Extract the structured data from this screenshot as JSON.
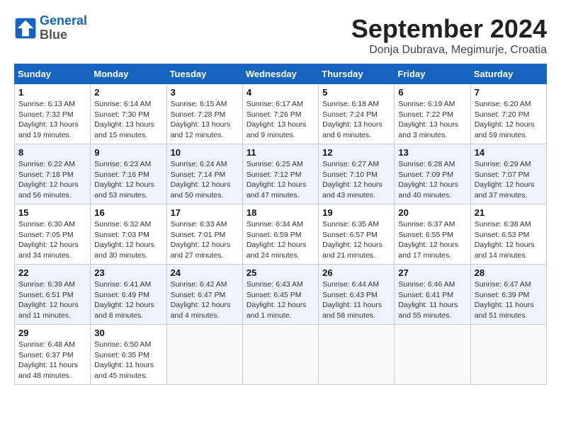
{
  "header": {
    "logo_line1": "General",
    "logo_line2": "Blue",
    "month_year": "September 2024",
    "location": "Donja Dubrava, Megimurje, Croatia"
  },
  "days_of_week": [
    "Sunday",
    "Monday",
    "Tuesday",
    "Wednesday",
    "Thursday",
    "Friday",
    "Saturday"
  ],
  "weeks": [
    [
      {
        "day": "1",
        "info": "Sunrise: 6:13 AM\nSunset: 7:32 PM\nDaylight: 13 hours and 19 minutes."
      },
      {
        "day": "2",
        "info": "Sunrise: 6:14 AM\nSunset: 7:30 PM\nDaylight: 13 hours and 15 minutes."
      },
      {
        "day": "3",
        "info": "Sunrise: 6:15 AM\nSunset: 7:28 PM\nDaylight: 13 hours and 12 minutes."
      },
      {
        "day": "4",
        "info": "Sunrise: 6:17 AM\nSunset: 7:26 PM\nDaylight: 13 hours and 9 minutes."
      },
      {
        "day": "5",
        "info": "Sunrise: 6:18 AM\nSunset: 7:24 PM\nDaylight: 13 hours and 6 minutes."
      },
      {
        "day": "6",
        "info": "Sunrise: 6:19 AM\nSunset: 7:22 PM\nDaylight: 13 hours and 3 minutes."
      },
      {
        "day": "7",
        "info": "Sunrise: 6:20 AM\nSunset: 7:20 PM\nDaylight: 12 hours and 59 minutes."
      }
    ],
    [
      {
        "day": "8",
        "info": "Sunrise: 6:22 AM\nSunset: 7:18 PM\nDaylight: 12 hours and 56 minutes."
      },
      {
        "day": "9",
        "info": "Sunrise: 6:23 AM\nSunset: 7:16 PM\nDaylight: 12 hours and 53 minutes."
      },
      {
        "day": "10",
        "info": "Sunrise: 6:24 AM\nSunset: 7:14 PM\nDaylight: 12 hours and 50 minutes."
      },
      {
        "day": "11",
        "info": "Sunrise: 6:25 AM\nSunset: 7:12 PM\nDaylight: 12 hours and 47 minutes."
      },
      {
        "day": "12",
        "info": "Sunrise: 6:27 AM\nSunset: 7:10 PM\nDaylight: 12 hours and 43 minutes."
      },
      {
        "day": "13",
        "info": "Sunrise: 6:28 AM\nSunset: 7:09 PM\nDaylight: 12 hours and 40 minutes."
      },
      {
        "day": "14",
        "info": "Sunrise: 6:29 AM\nSunset: 7:07 PM\nDaylight: 12 hours and 37 minutes."
      }
    ],
    [
      {
        "day": "15",
        "info": "Sunrise: 6:30 AM\nSunset: 7:05 PM\nDaylight: 12 hours and 34 minutes."
      },
      {
        "day": "16",
        "info": "Sunrise: 6:32 AM\nSunset: 7:03 PM\nDaylight: 12 hours and 30 minutes."
      },
      {
        "day": "17",
        "info": "Sunrise: 6:33 AM\nSunset: 7:01 PM\nDaylight: 12 hours and 27 minutes."
      },
      {
        "day": "18",
        "info": "Sunrise: 6:34 AM\nSunset: 6:59 PM\nDaylight: 12 hours and 24 minutes."
      },
      {
        "day": "19",
        "info": "Sunrise: 6:35 AM\nSunset: 6:57 PM\nDaylight: 12 hours and 21 minutes."
      },
      {
        "day": "20",
        "info": "Sunrise: 6:37 AM\nSunset: 6:55 PM\nDaylight: 12 hours and 17 minutes."
      },
      {
        "day": "21",
        "info": "Sunrise: 6:38 AM\nSunset: 6:53 PM\nDaylight: 12 hours and 14 minutes."
      }
    ],
    [
      {
        "day": "22",
        "info": "Sunrise: 6:39 AM\nSunset: 6:51 PM\nDaylight: 12 hours and 11 minutes."
      },
      {
        "day": "23",
        "info": "Sunrise: 6:41 AM\nSunset: 6:49 PM\nDaylight: 12 hours and 8 minutes."
      },
      {
        "day": "24",
        "info": "Sunrise: 6:42 AM\nSunset: 6:47 PM\nDaylight: 12 hours and 4 minutes."
      },
      {
        "day": "25",
        "info": "Sunrise: 6:43 AM\nSunset: 6:45 PM\nDaylight: 12 hours and 1 minute."
      },
      {
        "day": "26",
        "info": "Sunrise: 6:44 AM\nSunset: 6:43 PM\nDaylight: 11 hours and 58 minutes."
      },
      {
        "day": "27",
        "info": "Sunrise: 6:46 AM\nSunset: 6:41 PM\nDaylight: 11 hours and 55 minutes."
      },
      {
        "day": "28",
        "info": "Sunrise: 6:47 AM\nSunset: 6:39 PM\nDaylight: 11 hours and 51 minutes."
      }
    ],
    [
      {
        "day": "29",
        "info": "Sunrise: 6:48 AM\nSunset: 6:37 PM\nDaylight: 11 hours and 48 minutes."
      },
      {
        "day": "30",
        "info": "Sunrise: 6:50 AM\nSunset: 6:35 PM\nDaylight: 11 hours and 45 minutes."
      },
      {
        "day": "",
        "info": ""
      },
      {
        "day": "",
        "info": ""
      },
      {
        "day": "",
        "info": ""
      },
      {
        "day": "",
        "info": ""
      },
      {
        "day": "",
        "info": ""
      }
    ]
  ]
}
